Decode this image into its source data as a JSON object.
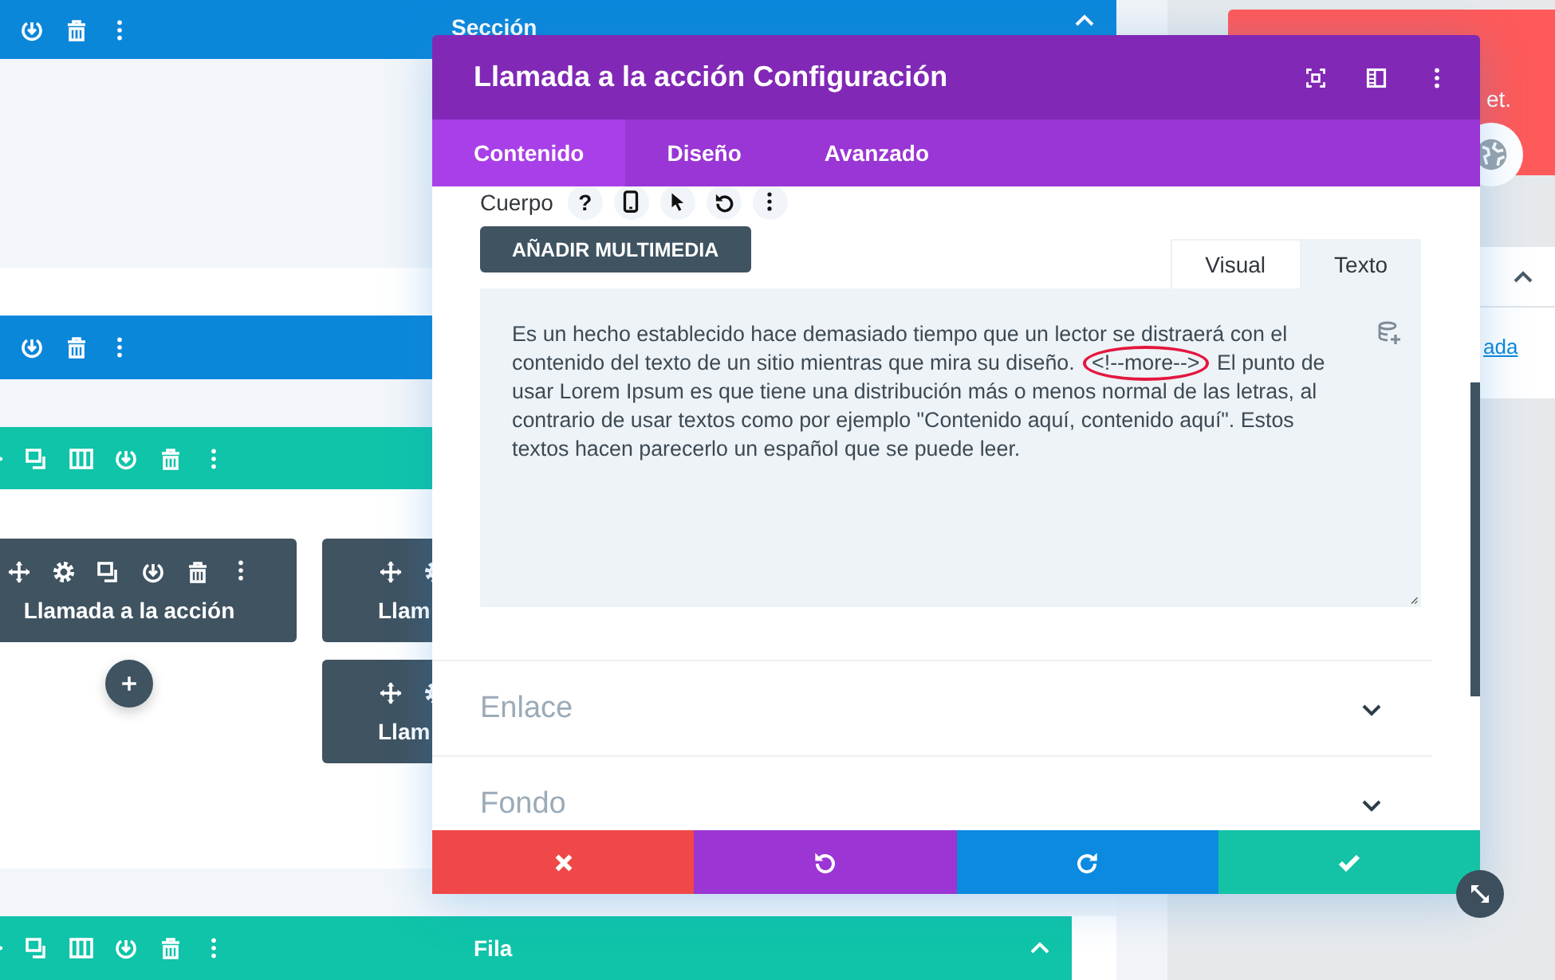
{
  "canvas": {
    "section_bar": {
      "label": "Sección",
      "expanded": true
    },
    "modules": [
      {
        "label": "Llamada a la acción"
      },
      {
        "label": "Llam"
      },
      {
        "label": "Llam"
      }
    ],
    "row_bar": {
      "label": "Fila",
      "expanded": true
    }
  },
  "side_panel": {
    "card_text": "et.",
    "link": "ada"
  },
  "modal": {
    "title": "Llamada a la acción Configuración",
    "tabs": [
      {
        "label": "Contenido",
        "selected": true
      },
      {
        "label": "Diseño",
        "selected": false
      },
      {
        "label": "Avanzado",
        "selected": false
      }
    ],
    "field": {
      "label": "Cuerpo",
      "help": "?"
    },
    "media_button": "AÑADIR MULTIMEDIA",
    "editor_tabs": [
      {
        "label": "Visual",
        "selected": false
      },
      {
        "label": "Texto",
        "selected": true
      }
    ],
    "body_text": {
      "before": "Es un hecho establecido hace demasiado tiempo que un lector se distraerá con el contenido del texto de un sitio mientras que mira su diseño. ",
      "marked": "<!--more-->",
      "after": " El punto de usar Lorem Ipsum es que tiene una distribución más o menos normal de las letras, al contrario de usar textos como por ejemplo \"Contenido aquí, contenido aquí\". Estos textos hacen parecerlo un español que se puede leer."
    },
    "groups": [
      {
        "label": "Enlace",
        "expanded": false
      },
      {
        "label": "Fondo",
        "expanded": false
      }
    ]
  }
}
